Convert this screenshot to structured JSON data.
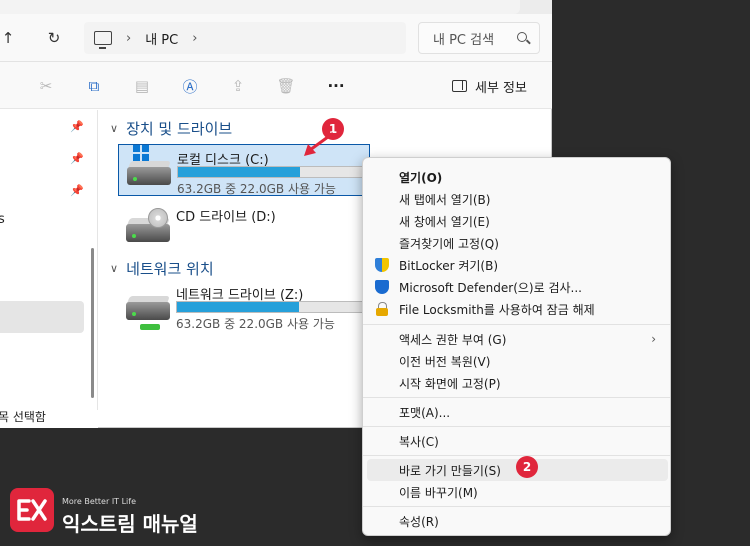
{
  "nav": {
    "back_icon": "up-arrow-icon",
    "refresh_icon": "refresh-icon",
    "breadcrumb_sep": "›",
    "location": "내 PC",
    "search_placeholder": "내 PC 검색"
  },
  "toolbar": {
    "more_label": "···",
    "details_label": "세부 정보"
  },
  "sidebar": {
    "fragment_top": "s",
    "status_text": "목 선택함"
  },
  "groups": {
    "devices": "장치 및 드라이브",
    "network": "네트워크 위치"
  },
  "drives": [
    {
      "name": "로컬 디스크 (C:)",
      "info": "63.2GB 중 22.0GB 사용 가능",
      "used_fraction": 0.65
    },
    {
      "name": "CD 드라이브 (D:)"
    },
    {
      "name": "네트워크 드라이브 (Z:)",
      "info": "63.2GB 중 22.0GB 사용 가능",
      "used_fraction": 0.65
    }
  ],
  "badges": {
    "one": "1",
    "two": "2"
  },
  "menu": {
    "open": "열기(O)",
    "open_new_tab": "새 탭에서 열기(B)",
    "open_new_window": "새 창에서 열기(E)",
    "pin_favorites": "즐겨찾기에 고정(Q)",
    "bitlocker": "BitLocker 켜기(B)",
    "defender": "Microsoft Defender(으)로 검사...",
    "locksmith": "File Locksmith를 사용하여 잠금 해제",
    "access": "액세스 권한 부여 (G)",
    "restore": "이전 버전 복원(V)",
    "pin_start": "시작 화면에 고정(P)",
    "format": "포맷(A)...",
    "copy": "복사(C)",
    "shortcut": "바로 가기 만들기(S)",
    "rename": "이름 바꾸기(M)",
    "properties": "속성(R)",
    "submenu_arrow": "›"
  },
  "brand": {
    "tagline": "More Better IT Life",
    "title": "익스트림 매뉴얼",
    "logo_mark": "EX"
  },
  "colors": {
    "accent": "#0a78d4",
    "badge": "#e0263c",
    "bar_fill": "#26a0da"
  }
}
